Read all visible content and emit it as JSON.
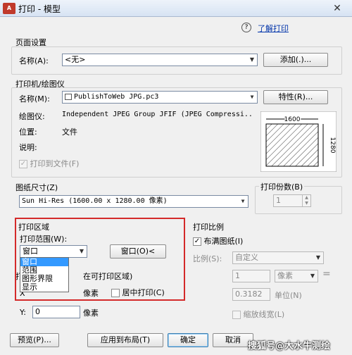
{
  "window": {
    "title": "打印 - 模型",
    "app_icon_text": "A",
    "help_icon": "?",
    "help_link": "了解打印"
  },
  "page_setup": {
    "heading": "页面设置",
    "name_label": "名称(A):",
    "name_value": "<无>",
    "add_button": "添加(.)..."
  },
  "printer": {
    "heading": "打印机/绘图仪",
    "name_label": "名称(M):",
    "name_value": "PublishToWeb JPG.pc3",
    "properties_button": "特性(R)...",
    "plotter_label": "绘图仪:",
    "plotter_value": "Independent JPEG Group JFIF (JPEG Compressi...",
    "location_label": "位置:",
    "location_value": "文件",
    "description_label": "说明:",
    "print_to_file_label": "打印到文件(F)",
    "preview_width": "1600",
    "preview_height": "1280"
  },
  "paper": {
    "heading": "图纸尺寸(Z)",
    "value": "Sun Hi-Res (1600.00 x 1280.00 像素)"
  },
  "copies": {
    "heading": "打印份数(B)",
    "value": "1"
  },
  "print_area": {
    "heading": "打印区域",
    "range_label": "打印范围(W):",
    "range_value": "窗口",
    "window_button": "窗口(O)<",
    "options": [
      "窗口",
      "范围",
      "图形界限",
      "显示"
    ]
  },
  "offset": {
    "heading_partial": "打",
    "heading_suffix": "在可打印区域)",
    "x_label_partial": "X",
    "x_unit": "像素",
    "center_label": "居中打印(C)",
    "y_label": "Y:",
    "y_value": "0",
    "y_unit": "像素"
  },
  "scale": {
    "heading": "打印比例",
    "fit_label": "布满图纸(I)",
    "ratio_label": "比例(S):",
    "ratio_value": "自定义",
    "value1": "1",
    "unit1": "像素",
    "value2": "0.3182",
    "unit2_label": "单位(N)",
    "lineweight_label": "缩放线宽(L)"
  },
  "footer": {
    "preview_button": "预览(P)...",
    "apply_button": "应用到布局(T)",
    "ok_button": "确定",
    "cancel_button": "取消"
  },
  "watermark": "搜狐号@大水牛测绘"
}
